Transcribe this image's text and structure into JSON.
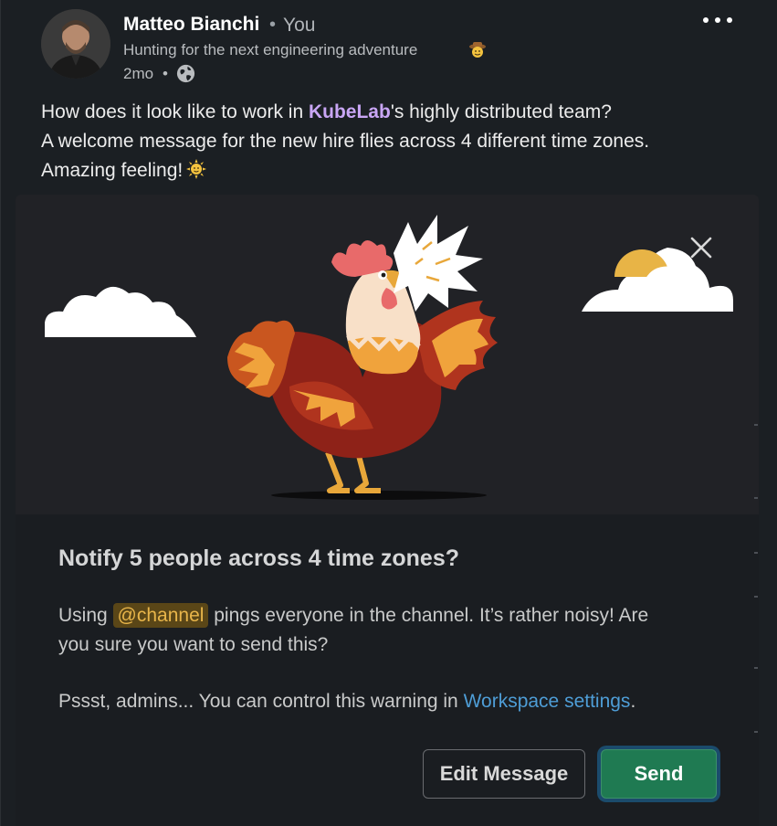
{
  "author": {
    "name": "Matteo Bianchi",
    "separator": "•",
    "relation": "You",
    "headline": "Hunting for the next engineering adventure",
    "timestamp": "2mo",
    "dot": "•"
  },
  "post": {
    "line1_before": "How does it look like to work in ",
    "line1_mention": "KubeLab",
    "line1_after": "'s highly distributed team?",
    "line2": "A welcome message for the new hire flies across 4 different time zones.",
    "line3": "Amazing feeling!"
  },
  "dialog": {
    "title": "Notify 5 people across 4 time zones?",
    "p1_before": "Using ",
    "p1_channel": "@channel",
    "p1_after": " pings everyone in the channel. It’s rather noisy! Are",
    "p1_line2": "you sure you want to send this?",
    "p2_before": "Pssst, admins... You can control this warning in ",
    "p2_link": "Workspace settings",
    "p2_after": ".",
    "edit_label": "Edit Message",
    "send_label": "Send"
  },
  "icons": {
    "more": "more-options-icon",
    "globe": "globe-icon",
    "close": "close-icon",
    "headline_emoji": "cowboy-emoji-icon",
    "post_emoji": "sun-emoji-icon"
  },
  "colors": {
    "background": "#1b1f23",
    "mention": "#c9a6f5",
    "channel_highlight": "#e8b54a",
    "link": "#4e9dd6",
    "send_button": "#1f7a52"
  }
}
